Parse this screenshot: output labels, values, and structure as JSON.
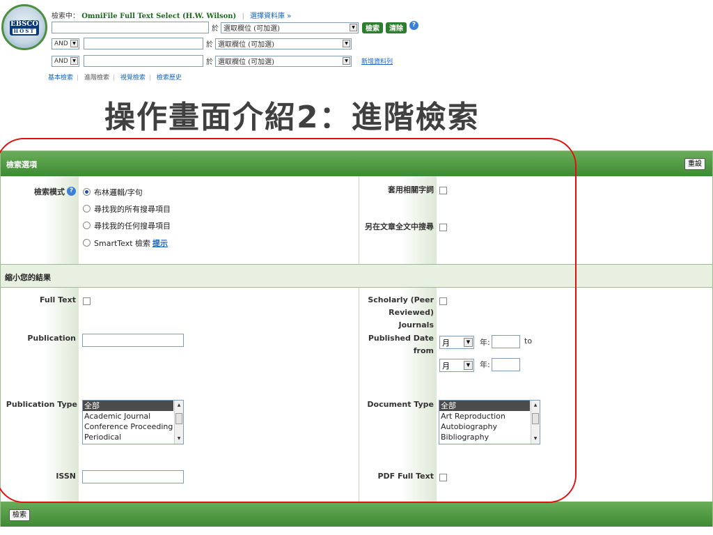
{
  "logo": {
    "brand": "EBSCO",
    "sub": "HOST"
  },
  "search": {
    "searching_label": "檢索中：",
    "database": "OmniFile Full Text Select (H.W. Wilson)",
    "choose_db_link": "選擇資料庫 »",
    "in_label": "於",
    "field_select_value": "選取欄位 (可加選)",
    "bool_value": "AND",
    "search_button": "檢索",
    "clear_button": "清除",
    "help_icon": "?",
    "add_row_link": "新增資料列",
    "rows": [
      {
        "bool": "",
        "term": "",
        "field": "選取欄位 (可加選)"
      },
      {
        "bool": "AND",
        "term": "",
        "field": "選取欄位 (可加選)"
      },
      {
        "bool": "AND",
        "term": "",
        "field": "選取欄位 (可加選)"
      }
    ]
  },
  "tabs": [
    {
      "label": "基本檢索"
    },
    {
      "label": "進階檢索"
    },
    {
      "label": "視覺檢索"
    },
    {
      "label": "檢索歷史"
    }
  ],
  "slide_title": "操作畫面介紹2：進階檢索",
  "options": {
    "header": "檢索選項",
    "reset_button": "重設",
    "search_mode_label": "檢索模式",
    "search_modes": [
      {
        "label": "布林邏輯/字句",
        "selected": true
      },
      {
        "label": "尋找我的所有搜尋項目",
        "selected": false
      },
      {
        "label": "尋找我的任何搜尋項目",
        "selected": false
      },
      {
        "label": "SmartText 檢索",
        "selected": false
      }
    ],
    "hint_link": "提示",
    "related_words_label": "套用相關字詞",
    "fulltext_search_label": "另在文章全文中搜尋"
  },
  "limit": {
    "header": "縮小您的結果",
    "full_text_label": "Full Text",
    "scholarly_label_1": "Scholarly (Peer",
    "scholarly_label_2": "Reviewed) Journals",
    "publication_label": "Publication",
    "published_date_label": "Published Date from",
    "month_value": "月",
    "year_label": "年:",
    "to_label": "to",
    "publication_type_label": "Publication Type",
    "publication_types": [
      "全部",
      "Academic Journal",
      "Conference Proceeding",
      "Periodical"
    ],
    "document_type_label": "Document Type",
    "document_types": [
      "全部",
      "Art Reproduction",
      "Autobiography",
      "Bibliography"
    ],
    "issn_label": "ISSN",
    "pdf_label": "PDF Full Text"
  },
  "footer": {
    "search_button": "檢索"
  },
  "colors": {
    "green_bar": "#4f9a42",
    "annotation": "#e01010",
    "link": "#1565c0"
  }
}
